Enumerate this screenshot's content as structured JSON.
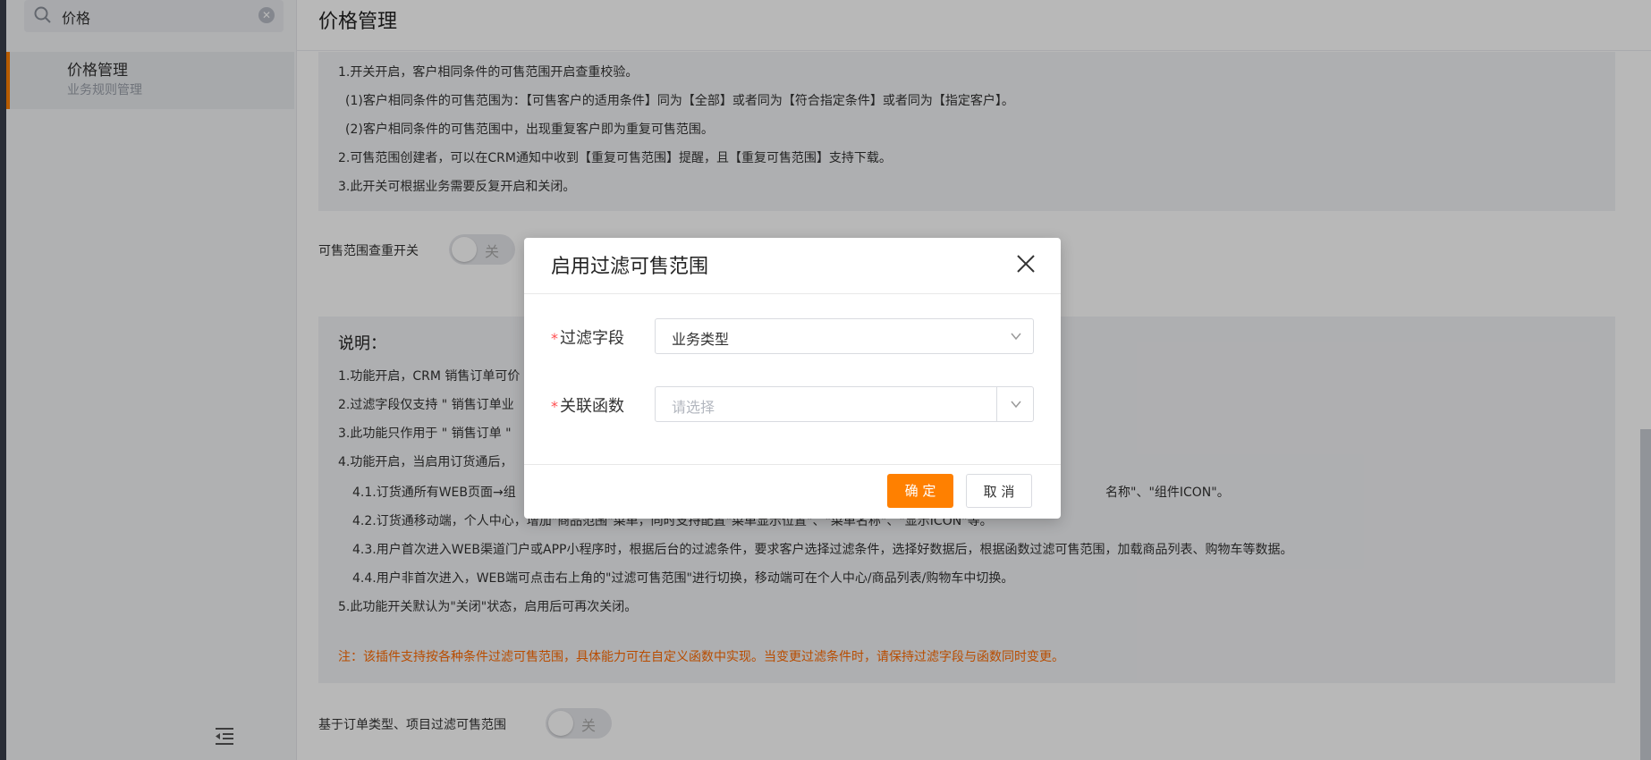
{
  "sidebar": {
    "search": {
      "value": "价格"
    },
    "items": [
      {
        "title": "价格管理",
        "subtitle": "业务规则管理"
      }
    ]
  },
  "main": {
    "title": "价格管理",
    "info1": {
      "lines": [
        "1.开关开启，客户相同条件的可售范围开启查重校验。",
        "(1)客户相同条件的可售范围为：【可售客户的适用条件】同为【全部】或者同为【符合指定条件】或者同为【指定客户】。",
        "(2)客户相同条件的可售范围中，出现重复客户即为重复可售范围。",
        "2.可售范围创建者，可以在CRM通知中收到【重复可售范围】提醒，且【重复可售范围】支持下载。",
        "3.此开关可根据业务需要反复开启和关闭。"
      ]
    },
    "switch1": {
      "label": "可售范围查重开关",
      "state": "关"
    },
    "info2": {
      "title": "说明：",
      "lines": [
        "1.功能开启，CRM 销售订单可价",
        "2.过滤字段仅支持 \" 销售订单业",
        "3.此功能只作用于 \" 销售订单 \"",
        "4.功能开启，当启用订货通后，",
        "4.1.订货通所有WEB页面→组",
        "4.2.订货通移动端，个人中心，增加\"商品范围\"菜单，同时支持配置\"菜单显示位置\"、\"菜单名称\"、\"显示ICON\"等。",
        "4.3.用户首次进入WEB渠道门户或APP小程序时，根据后台的过滤条件，要求客户选择过滤条件，选择好数据后，根据函数过滤可售范围，加载商品列表、购物车等数据。",
        "4.4.用户非首次进入，WEB端可点击右上角的\"过滤可售范围\"进行切换，移动端可在个人中心/商品列表/购物车中切换。",
        "5.此功能开关默认为\"关闭\"状态，启用后可再次关闭。"
      ],
      "right_fragment": "名称\"、\"组件ICON\"。",
      "note": "注：该插件支持按各种条件过滤可售范围，具体能力可在自定义函数中实现。当变更过滤条件时，请保持过滤字段与函数同时变更。"
    },
    "switch2": {
      "label": "基于订单类型、项目过滤可售范围",
      "state": "关"
    }
  },
  "modal": {
    "title": "启用过滤可售范围",
    "fields": [
      {
        "label": "过滤字段",
        "value": "业务类型"
      },
      {
        "label": "关联函数",
        "placeholder": "请选择"
      }
    ],
    "ok_label": "确 定",
    "cancel_label": "取 消"
  },
  "colors": {
    "accent": "#ff8000",
    "note": "#ff6a00",
    "required": "#ff4d4f"
  }
}
